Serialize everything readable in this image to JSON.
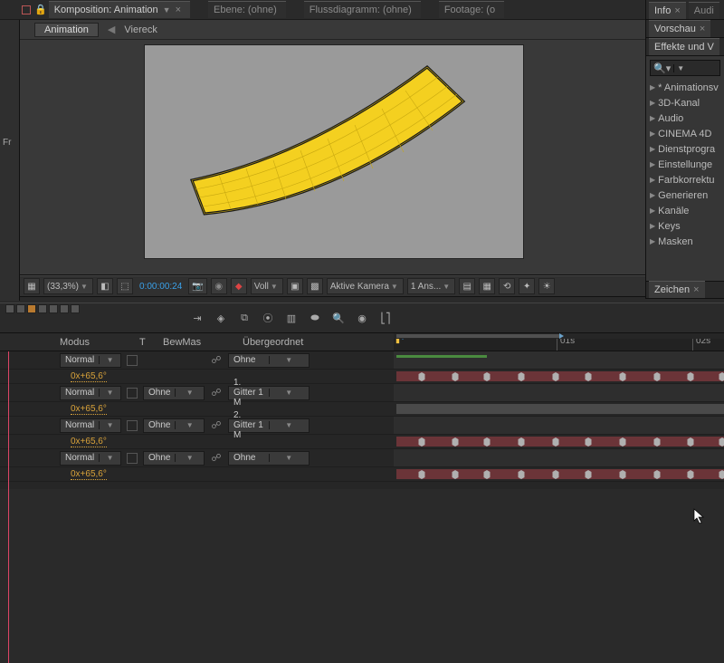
{
  "top_tabs": {
    "comp": "Komposition: Animation",
    "layer": "Ebene: (ohne)",
    "flow": "Flussdiagramm: (ohne)",
    "footage": "Footage: (o"
  },
  "breadcrumb": {
    "main": "Animation",
    "sub": "Viereck"
  },
  "statusbar": {
    "zoom": "(33,3%)",
    "timecode": "0:00:00:24",
    "view_mode": "Voll",
    "camera": "Aktive Kamera",
    "views": "1 Ans..."
  },
  "right": {
    "tabs": {
      "info": "Info",
      "audio": "Audi"
    },
    "preview": "Vorschau",
    "effects_title": "Effekte und V",
    "effects": [
      "* Animationsv",
      "3D-Kanal",
      "Audio",
      "CINEMA 4D",
      "Dienstprogra",
      "Einstellunge",
      "Farbkorrektu",
      "Generieren",
      "Kanäle",
      "Keys",
      "Masken"
    ],
    "draw": "Zeichen"
  },
  "left_sliver": "Fr",
  "timeline": {
    "cols": {
      "mode": "Modus",
      "t": "T",
      "trkmat": "BewMas",
      "parent": "Übergeordnet"
    },
    "ruler": {
      "t1": "01s",
      "t2": "02s"
    },
    "rows": [
      {
        "mode": "Normal",
        "trkmat": "",
        "parent": "Ohne",
        "rot": "0x+65,6°",
        "bar": "red",
        "kf": true
      },
      {
        "mode": "Normal",
        "trkmat": "Ohne",
        "parent": "1. Gitter 1 M",
        "rot": "0x+65,6°",
        "bar": "grey",
        "kf": false
      },
      {
        "mode": "Normal",
        "trkmat": "Ohne",
        "parent": "2. Gitter 1 M",
        "rot": "0x+65,6°",
        "bar": "red",
        "kf": true
      },
      {
        "mode": "Normal",
        "trkmat": "Ohne",
        "parent": "Ohne",
        "rot": "0x+65,6°",
        "bar": "red",
        "kf": true
      }
    ]
  }
}
